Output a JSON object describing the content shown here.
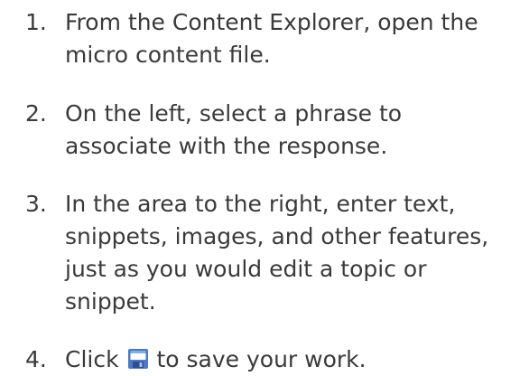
{
  "steps": [
    {
      "number": "1.",
      "text": "From the Content Explorer, open the\nmicro content file."
    },
    {
      "number": "2.",
      "text": "On the left, select a phrase to\nassociate with the response."
    },
    {
      "number": "3.",
      "text": "In the area to the right, enter text,\nsnippets, images, and other features,\njust as you would edit a topic or\nsnippet."
    },
    {
      "number": "4.",
      "text_before": "Click",
      "icon": "save-icon",
      "text_after": "to save your work."
    }
  ],
  "colors": {
    "text": "#3a3a3a",
    "icon_frame": "#4a79c9",
    "icon_fill": "#7fb0ee"
  }
}
